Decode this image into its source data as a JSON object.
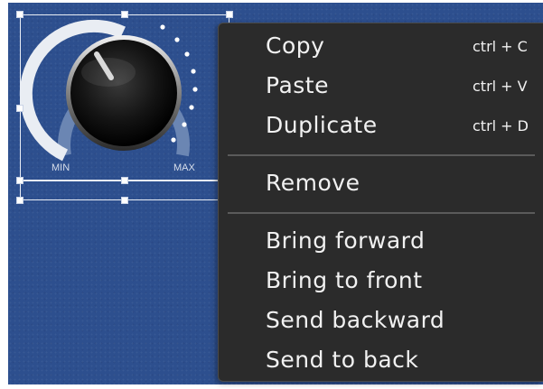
{
  "control": {
    "type_icon": "rotary-knob-icon",
    "min_label": "MIN",
    "max_label": "MAX"
  },
  "context_menu": {
    "groups": [
      [
        {
          "label": "Copy",
          "shortcut": "ctrl + C"
        },
        {
          "label": "Paste",
          "shortcut": "ctrl + V"
        },
        {
          "label": "Duplicate",
          "shortcut": "ctrl + D"
        }
      ],
      [
        {
          "label": "Remove"
        }
      ],
      [
        {
          "label": "Bring forward"
        },
        {
          "label": "Bring to front"
        },
        {
          "label": "Send backward"
        },
        {
          "label": "Send to back"
        }
      ]
    ]
  },
  "colors": {
    "panel_background": "#2d4f8e",
    "menu_background": "#2b2b2b",
    "menu_text": "#f1f1f1",
    "selection": "#e8edf5"
  }
}
